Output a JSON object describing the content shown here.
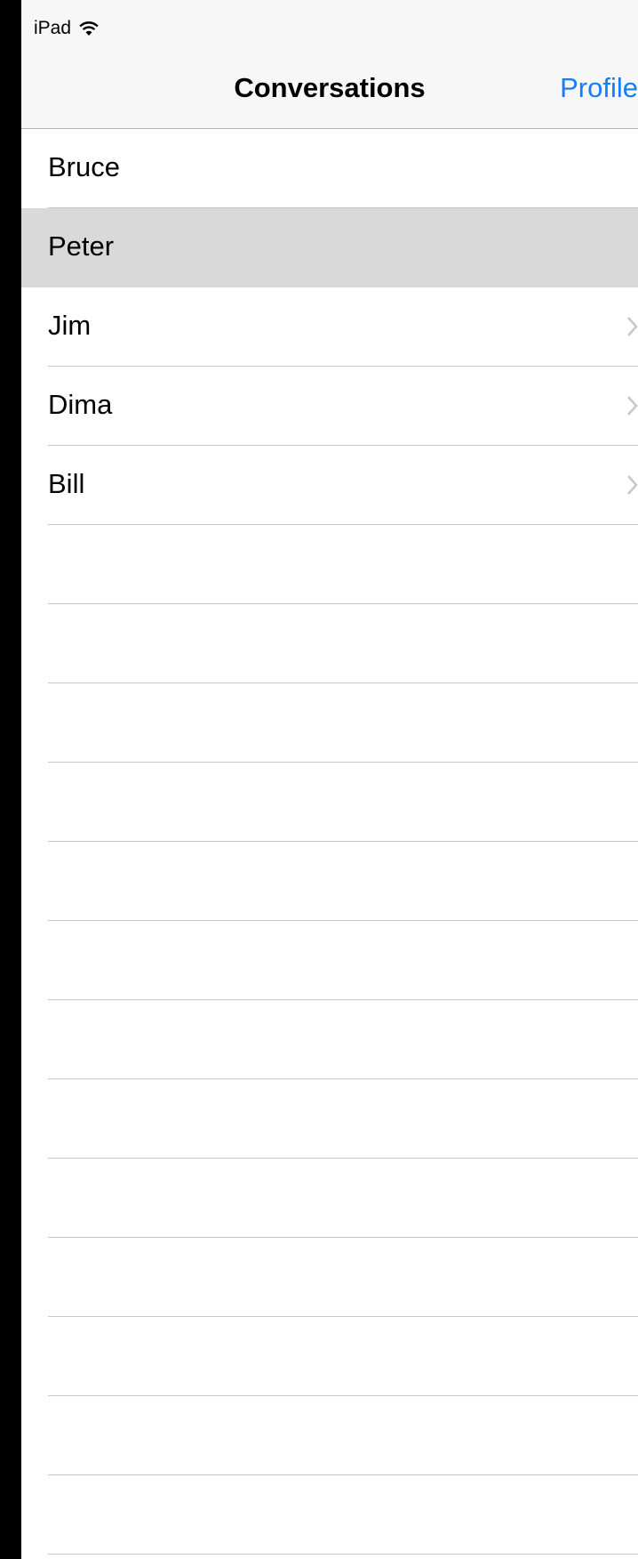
{
  "status_bar": {
    "carrier": "iPad",
    "wifi_icon": "wifi-icon"
  },
  "nav_bar": {
    "title": "Conversations",
    "right_button": "Profile",
    "accent_color": "#157efb"
  },
  "conversations": [
    {
      "name": "Bruce",
      "selected": false,
      "chevron": false
    },
    {
      "name": "Peter",
      "selected": true,
      "chevron": false
    },
    {
      "name": "Jim",
      "selected": false,
      "chevron": true
    },
    {
      "name": "Dima",
      "selected": false,
      "chevron": true
    },
    {
      "name": "Bill",
      "selected": false,
      "chevron": true
    }
  ],
  "colors": {
    "selected_row": "#d9d9d9",
    "separator": "#c8c7cc",
    "bar_background": "#f7f7f7"
  }
}
